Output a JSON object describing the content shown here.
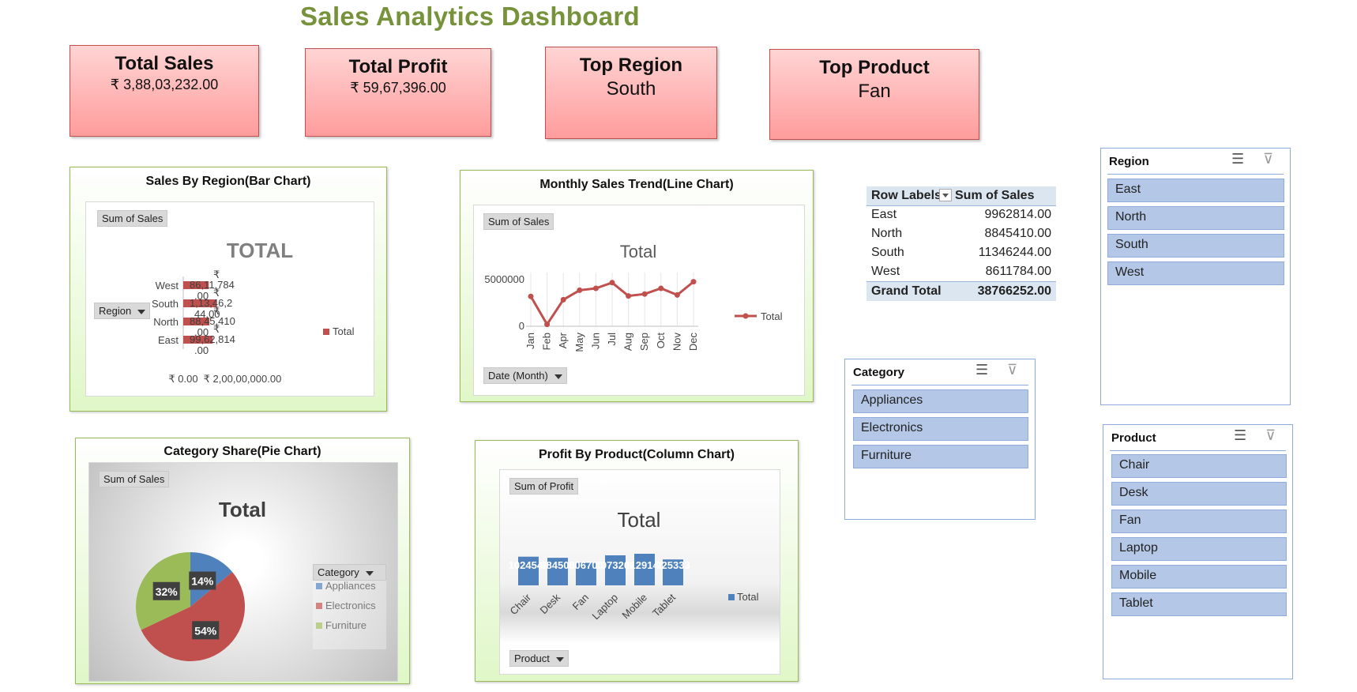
{
  "dashboard": {
    "title": "Sales Analytics Dashboard"
  },
  "kpis": [
    {
      "title": "Total Sales",
      "value": "₹ 3,88,03,232.00"
    },
    {
      "title": "Total Profit",
      "value": "₹ 59,67,396.00"
    },
    {
      "title": "Top Region",
      "value": "South"
    },
    {
      "title": "Top Product",
      "value": "Fan"
    }
  ],
  "region_chart": {
    "title": "Sales By Region(Bar Chart)",
    "value_field": "Sum of Sales",
    "row_field": "Region",
    "legend": "Total",
    "chart_title": "TOTAL",
    "x_tick_labels": [
      "₹ 0.00",
      "₹ 2,00,00,000.00"
    ]
  },
  "trend_chart": {
    "title": "Monthly Sales Trend(Line Chart)",
    "value_field": "Sum of Sales",
    "axis_field": "Date  (Month)",
    "legend": "Total",
    "chart_title": "Total",
    "y_tick_labels": [
      "5000000",
      "0"
    ]
  },
  "pie_chart": {
    "title": "Category Share(Pie Chart)",
    "value_field": "Sum of Sales",
    "legend_field": "Category",
    "chart_title": "Total"
  },
  "profit_chart": {
    "title": "Profit By Product(Column Chart)",
    "value_field": "Sum of Profit",
    "axis_field": "Product",
    "legend": "Total",
    "chart_title": "Total"
  },
  "chart_data": [
    {
      "type": "bar",
      "title": "TOTAL",
      "categories": [
        "East",
        "North",
        "South",
        "West"
      ],
      "series": [
        {
          "name": "Total",
          "values": [
            9962814,
            8845410,
            11346244,
            8611784
          ]
        }
      ],
      "data_labels": [
        "99,62,814 .00",
        "88,45,410 .00",
        "1,13,46,2 44.00",
        "86,11,784 .00"
      ],
      "xlim": [
        0,
        20000000
      ],
      "legend": "right",
      "colors": {
        "series": "#c0504d"
      }
    },
    {
      "type": "line",
      "title": "Total",
      "categories": [
        "Jan",
        "Feb",
        "Apr",
        "May",
        "Jun",
        "Jul",
        "Aug",
        "Sep",
        "Oct",
        "Nov",
        "Dec"
      ],
      "series": [
        {
          "name": "Total",
          "values": [
            3150000,
            200000,
            2800000,
            3800000,
            4000000,
            4600000,
            3200000,
            3400000,
            4000000,
            3300000,
            4700000
          ]
        }
      ],
      "ylim": [
        0,
        6000000
      ],
      "legend": "right",
      "colors": {
        "series": "#c0504d"
      }
    },
    {
      "type": "pie",
      "title": "Total",
      "categories": [
        "Appliances",
        "Electronics",
        "Furniture"
      ],
      "values": [
        14,
        54,
        32
      ],
      "labels": [
        "14%",
        "54%",
        "32%"
      ],
      "legend": "right",
      "colors": {
        "Appliances": "#4f81bd",
        "Electronics": "#c0504d",
        "Furniture": "#9bbb59"
      }
    },
    {
      "type": "bar",
      "title": "Total",
      "categories": [
        "Chair",
        "Desk",
        "Fan",
        "Laptop",
        "Mobile",
        "Tablet"
      ],
      "series": [
        {
          "name": "Total",
          "values": [
            1024540,
            984500,
            806700,
            1073200,
            1129140,
            925333
          ]
        }
      ],
      "data_labels": [
        "1024540",
        "984500",
        "806700",
        "1073200",
        "1129140",
        "925333"
      ],
      "legend": "right",
      "colors": {
        "series": "#4f81bd"
      }
    }
  ],
  "pivot_table": {
    "headers": [
      "Row Labels",
      "Sum of Sales"
    ],
    "rows": [
      {
        "label": "East",
        "value": "9962814.00"
      },
      {
        "label": "North",
        "value": "8845410.00"
      },
      {
        "label": "South",
        "value": "11346244.00"
      },
      {
        "label": "West",
        "value": "8611784.00"
      }
    ],
    "total": {
      "label": "Grand Total",
      "value": "38766252.00"
    }
  },
  "slicers": {
    "region": {
      "title": "Region",
      "items": [
        "East",
        "North",
        "South",
        "West"
      ]
    },
    "category": {
      "title": "Category",
      "items": [
        "Appliances",
        "Electronics",
        "Furniture"
      ]
    },
    "product": {
      "title": "Product",
      "items": [
        "Chair",
        "Desk",
        "Fan",
        "Laptop",
        "Mobile",
        "Tablet"
      ]
    }
  }
}
